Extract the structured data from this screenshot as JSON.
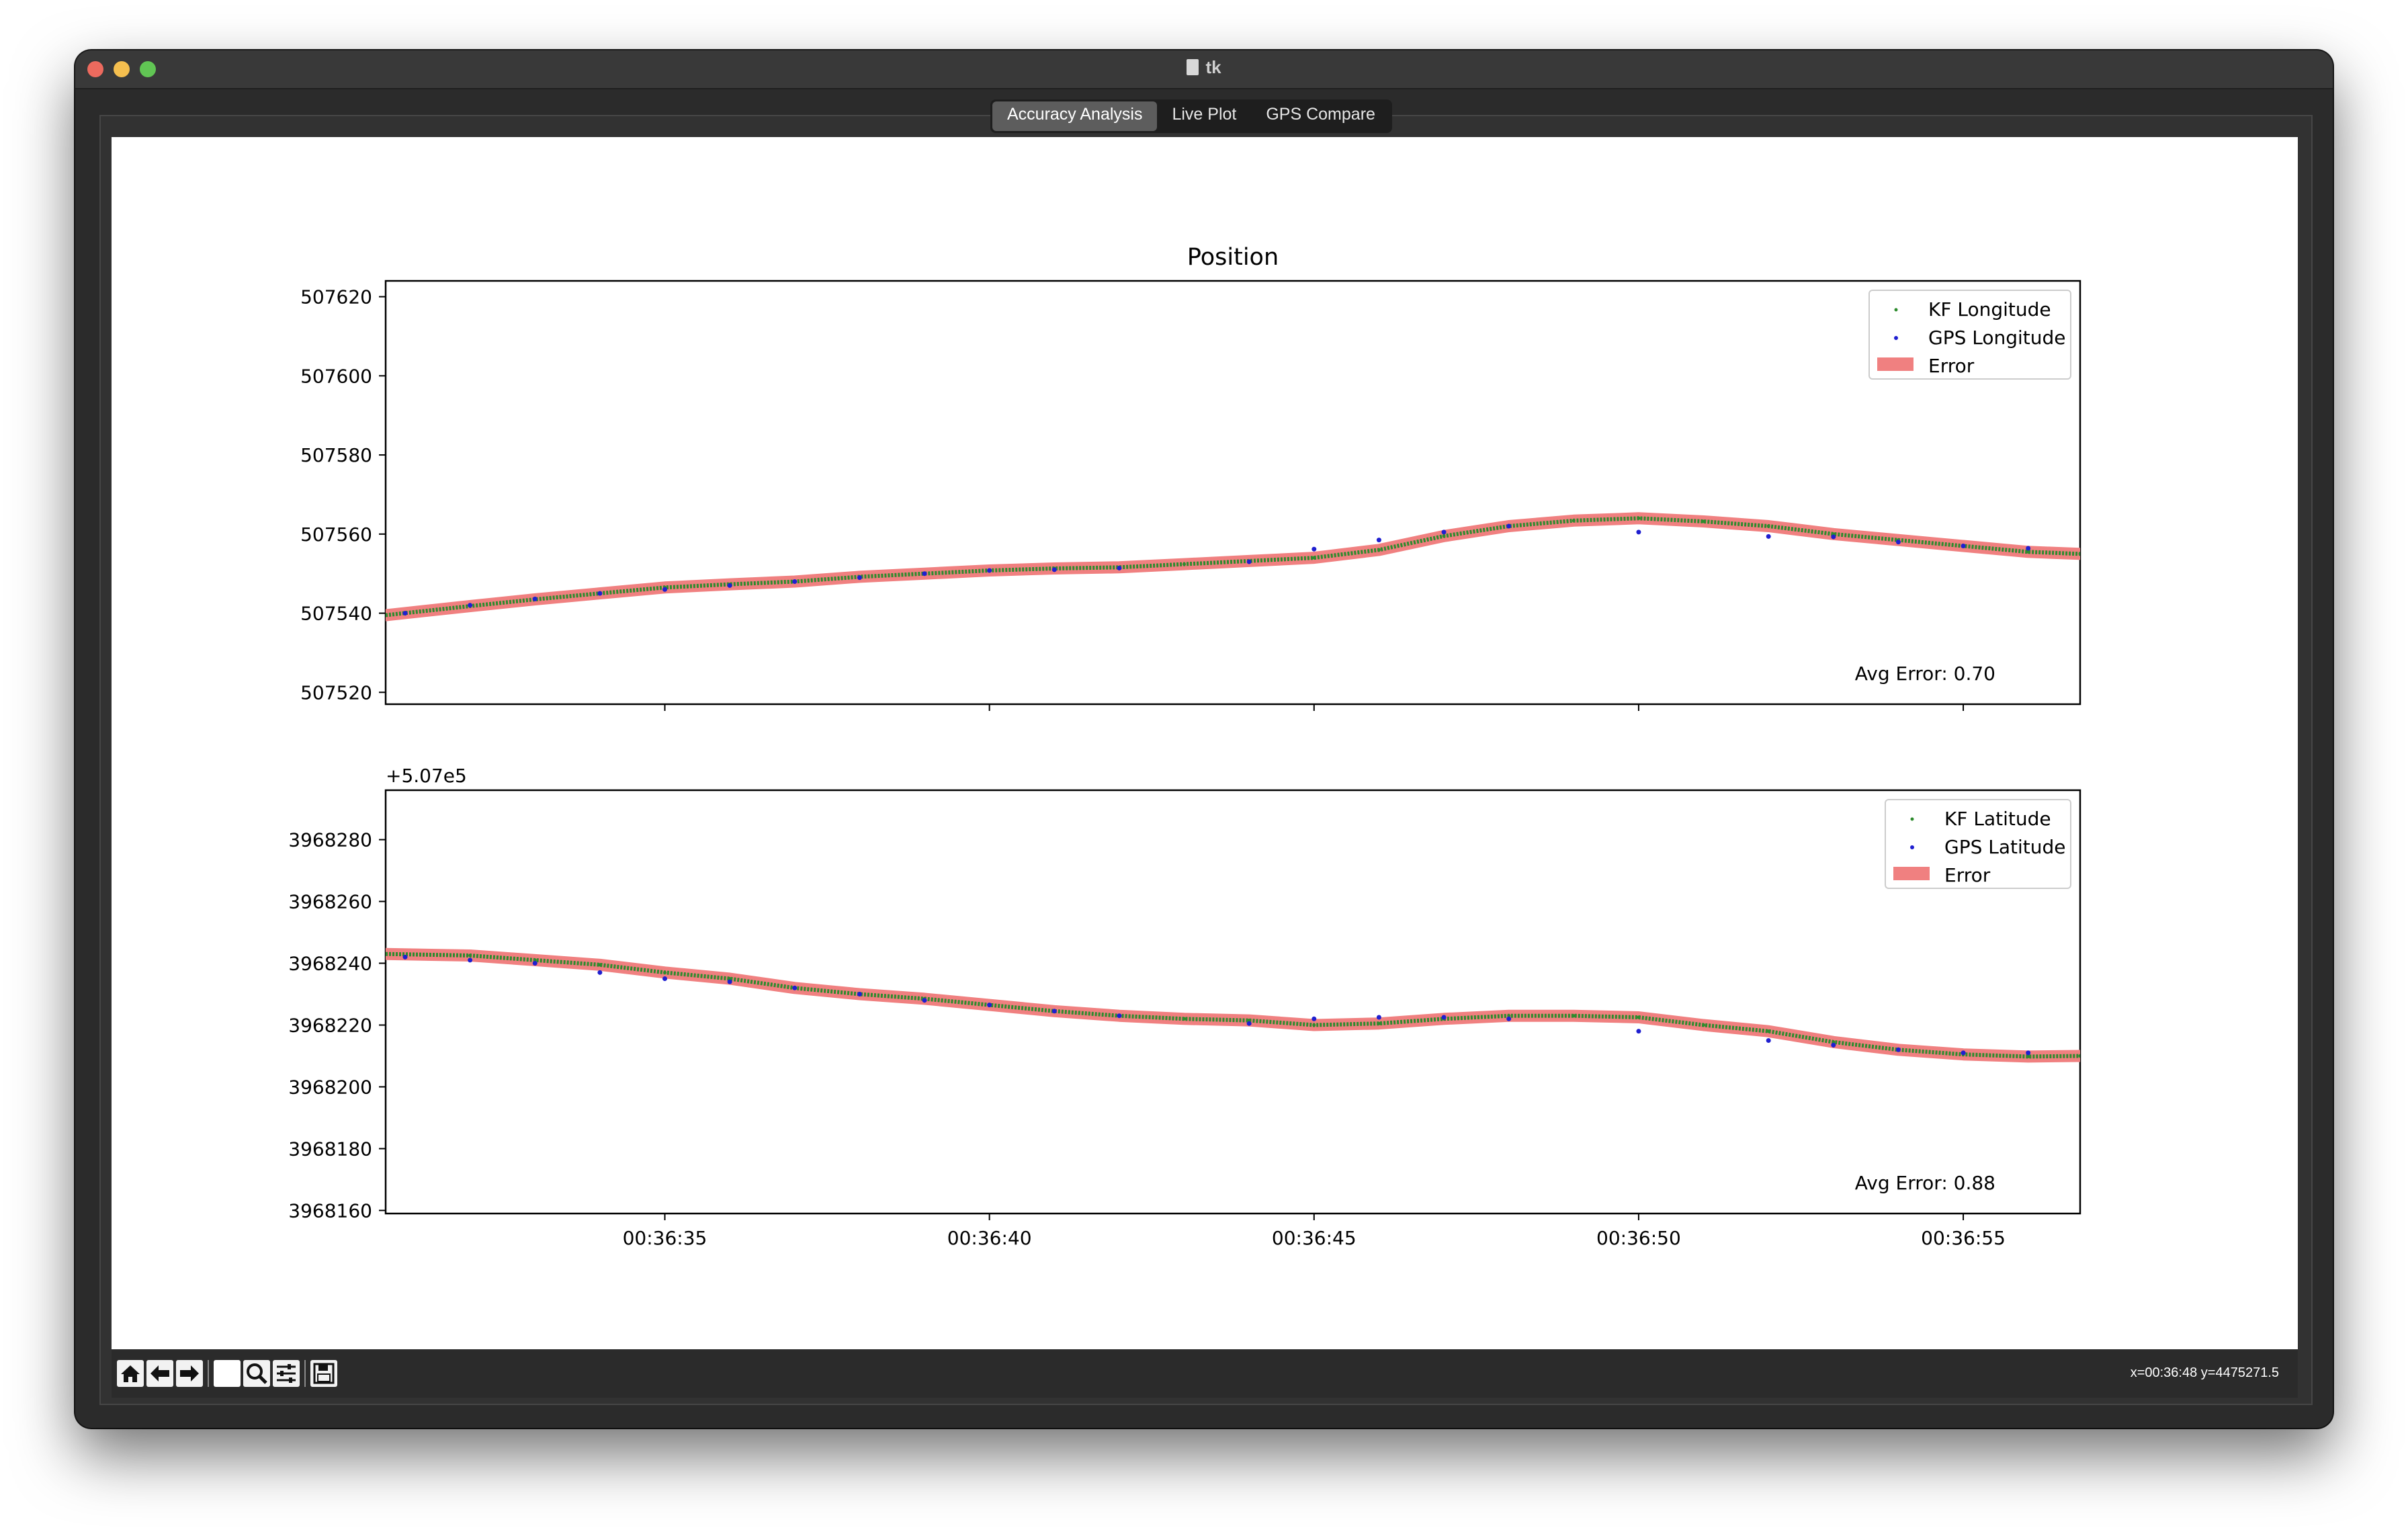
{
  "window": {
    "title": "tk"
  },
  "tabs": [
    {
      "label": "Accuracy Analysis",
      "active": true
    },
    {
      "label": "Live Plot",
      "active": false
    },
    {
      "label": "GPS Compare",
      "active": false
    }
  ],
  "figure": {
    "title": "Position",
    "x_ticks": [
      "00:36:35",
      "00:36:40",
      "00:36:45",
      "00:36:50",
      "00:36:55"
    ]
  },
  "chart_data": [
    {
      "type": "line",
      "title": "Position",
      "xlabel": "",
      "ylabel": "",
      "x_range": [
        "00:36:30.7",
        "00:36:56.8"
      ],
      "ylim": [
        507517,
        507624
      ],
      "y_ticks": [
        507520,
        507540,
        507560,
        507580,
        507600,
        507620
      ],
      "y_tick_labels": [
        "507520",
        "507540",
        "507560",
        "507580",
        "507600",
        "507620"
      ],
      "offset_text": "+5.07e5",
      "legend": {
        "placement": "top-right",
        "entries": [
          "KF Longitude",
          "GPS Longitude",
          "Error"
        ]
      },
      "annotation": "Avg Error: 0.70",
      "colors": {
        "kf": "#2e8b2e",
        "gps": "#1f1fd0",
        "error": "#f08080"
      },
      "series": [
        {
          "name": "KF Longitude",
          "x": [
            "00:36:30.7",
            "00:36:32",
            "00:36:33",
            "00:36:34",
            "00:36:35",
            "00:36:36",
            "00:36:37",
            "00:36:38",
            "00:36:39",
            "00:36:40",
            "00:36:41",
            "00:36:42",
            "00:36:43",
            "00:36:44",
            "00:36:45",
            "00:36:46",
            "00:36:47",
            "00:36:48",
            "00:36:49",
            "00:36:50",
            "00:36:51",
            "00:36:52",
            "00:36:53",
            "00:36:54",
            "00:36:55",
            "00:36:56",
            "00:36:56.8"
          ],
          "values": [
            507539.5,
            507541.8,
            507543.5,
            507545,
            507546.5,
            507547.3,
            507548,
            507549.2,
            507550,
            507550.8,
            507551.3,
            507551.6,
            507552.4,
            507553.2,
            507554,
            507556,
            507559.5,
            507562,
            507563.4,
            507564,
            507563.2,
            507562,
            507560,
            507558.5,
            507557,
            507555.5,
            507555
          ]
        },
        {
          "name": "GPS Longitude",
          "x": [
            "00:36:31",
            "00:36:32",
            "00:36:33",
            "00:36:34",
            "00:36:35",
            "00:36:36",
            "00:36:37",
            "00:36:38",
            "00:36:39",
            "00:36:40",
            "00:36:41",
            "00:36:42",
            "00:36:44",
            "00:36:45",
            "00:36:46",
            "00:36:47",
            "00:36:48",
            "00:36:50",
            "00:36:52",
            "00:36:53",
            "00:36:54",
            "00:36:55",
            "00:36:56"
          ],
          "values": [
            507540,
            507542,
            507543.6,
            507545,
            507546,
            507547,
            507548,
            507549,
            507550,
            507550.8,
            507551,
            507551.4,
            507553,
            507556.2,
            507558.5,
            507560.5,
            507562,
            507560.5,
            507559.4,
            507559.3,
            507558,
            507557,
            507556.4
          ]
        }
      ]
    },
    {
      "type": "line",
      "title": "",
      "xlabel": "",
      "ylabel": "",
      "x_range": [
        "00:36:30.7",
        "00:36:56.8"
      ],
      "ylim": [
        3968159,
        3968296
      ],
      "y_ticks": [
        3968160,
        3968180,
        3968200,
        3968220,
        3968240,
        3968260,
        3968280
      ],
      "y_tick_labels": [
        "3968160",
        "3968180",
        "3968200",
        "3968220",
        "3968240",
        "3968260",
        "3968280"
      ],
      "legend": {
        "placement": "top-right",
        "entries": [
          "KF Latitude",
          "GPS Latitude",
          "Error"
        ]
      },
      "annotation": "Avg Error: 0.88",
      "colors": {
        "kf": "#2e8b2e",
        "gps": "#1f1fd0",
        "error": "#f08080"
      },
      "series": [
        {
          "name": "KF Latitude",
          "x": [
            "00:36:30.7",
            "00:36:32",
            "00:36:33",
            "00:36:34",
            "00:36:35",
            "00:36:36",
            "00:36:37",
            "00:36:38",
            "00:36:39",
            "00:36:40",
            "00:36:41",
            "00:36:42",
            "00:36:43",
            "00:36:44",
            "00:36:45",
            "00:36:46",
            "00:36:47",
            "00:36:48",
            "00:36:49",
            "00:36:50",
            "00:36:51",
            "00:36:52",
            "00:36:53",
            "00:36:54",
            "00:36:55",
            "00:36:56",
            "00:36:56.8"
          ],
          "values": [
            3968243,
            3968242.5,
            3968241,
            3968239.5,
            3968237,
            3968235,
            3968232,
            3968230,
            3968228.5,
            3968226.5,
            3968224.5,
            3968223,
            3968222,
            3968221.5,
            3968220,
            3968220.5,
            3968222,
            3968223,
            3968223,
            3968222.5,
            3968220,
            3968218,
            3968214.5,
            3968212,
            3968210.5,
            3968209.8,
            3968210
          ]
        },
        {
          "name": "GPS Latitude",
          "x": [
            "00:36:31",
            "00:36:32",
            "00:36:33",
            "00:36:34",
            "00:36:35",
            "00:36:36",
            "00:36:37",
            "00:36:38",
            "00:36:39",
            "00:36:40",
            "00:36:41",
            "00:36:42",
            "00:36:44",
            "00:36:45",
            "00:36:46",
            "00:36:47",
            "00:36:48",
            "00:36:50",
            "00:36:52",
            "00:36:53",
            "00:36:54",
            "00:36:55",
            "00:36:56"
          ],
          "values": [
            3968242,
            3968241,
            3968240,
            3968237,
            3968235,
            3968234,
            3968232,
            3968230,
            3968228,
            3968226.5,
            3968224.5,
            3968223,
            3968220.5,
            3968222,
            3968222.5,
            3968222.5,
            3968222,
            3968218,
            3968215,
            3968213.5,
            3968212,
            3968211,
            3968211
          ]
        }
      ]
    }
  ],
  "toolbar": {
    "icons": [
      "home-icon",
      "back-arrow-icon",
      "forward-arrow-icon",
      "pan-icon",
      "zoom-icon",
      "configure-subplots-icon",
      "save-icon"
    ],
    "coords_text": "x=00:36:48 y=4475271.5"
  }
}
